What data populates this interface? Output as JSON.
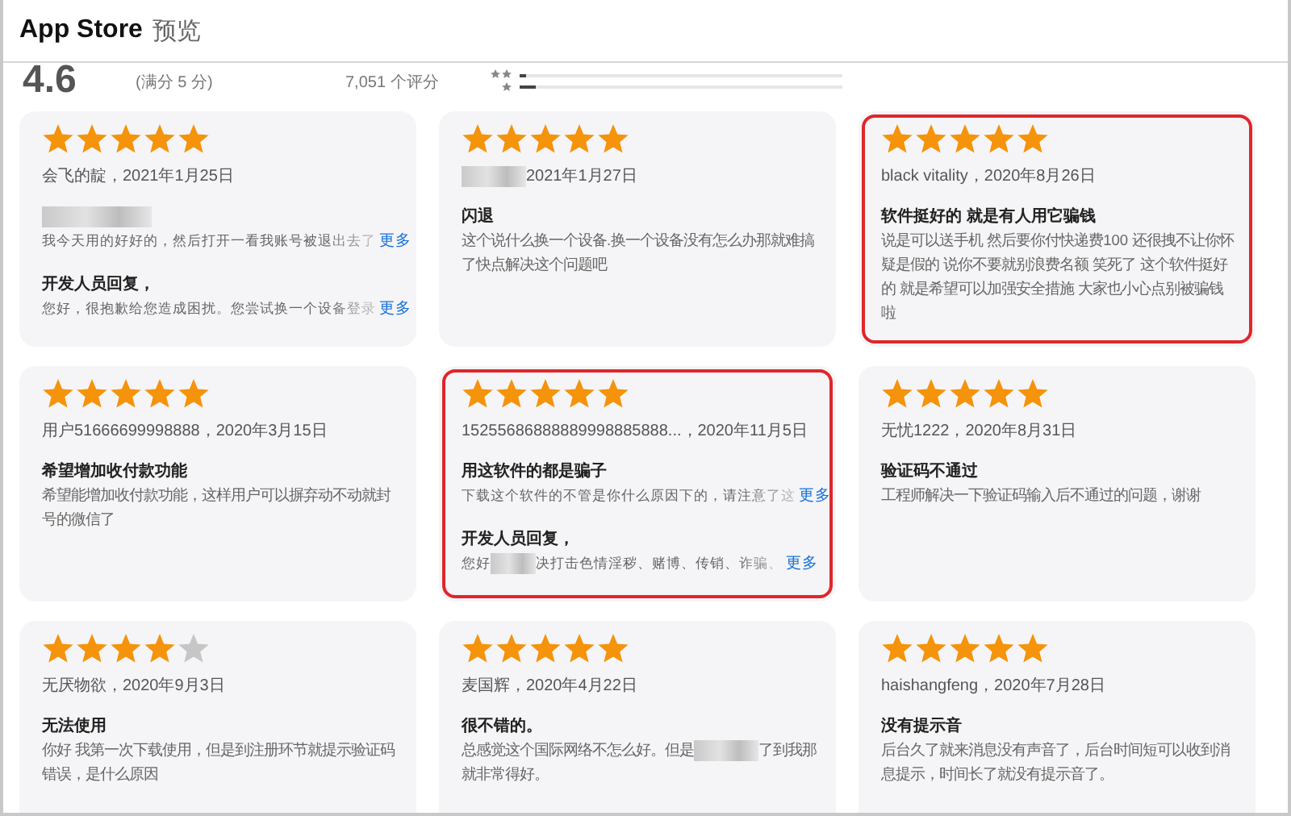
{
  "header": {
    "brand": "App Store",
    "subtitle": "预览"
  },
  "summary": {
    "score": "4.6",
    "out_of": "(满分 5 分)",
    "count": "7,051 个评分"
  },
  "reviews": [
    {
      "stars": 5,
      "highlighted": false,
      "author": [
        {
          "kind": "text",
          "text": "会飞的靛，2021年1月25日"
        }
      ],
      "title": [
        {
          "kind": "redacted"
        }
      ],
      "body": [
        {
          "kind": "text",
          "text": "我今天用的好好的，然后打开一看我账号被退出去了"
        }
      ],
      "body_more": "更多",
      "reply_title": "开发人员回复，",
      "reply": [
        {
          "kind": "text",
          "text": "您好，很抱歉给您造成困扰。您尝试换一个设备登录"
        }
      ],
      "reply_more": "更多"
    },
    {
      "stars": 5,
      "highlighted": false,
      "author": [
        {
          "kind": "redacted"
        },
        {
          "kind": "text",
          "text": "2021年1月27日"
        }
      ],
      "title": [
        {
          "kind": "text",
          "text": "闪退"
        }
      ],
      "body": [
        {
          "kind": "text",
          "text": "这个说什么换一个设备.换一个设备没有怎么办那就难搞了快点解决这个问题吧"
        }
      ]
    },
    {
      "stars": 5,
      "highlighted": true,
      "author": [
        {
          "kind": "text",
          "text": "black vitality，2020年8月26日"
        }
      ],
      "title": [
        {
          "kind": "text",
          "text": "软件挺好的 就是有人用它骗钱"
        }
      ],
      "body": [
        {
          "kind": "text",
          "text": "说是可以送手机 然后要你付快递费100 还很拽不让你怀疑是假的 说你不要就别浪费名额 笑死了 这个软件挺好的 就是希望可以加强安全措施 大家也小心点别被骗钱啦"
        }
      ]
    },
    {
      "stars": 5,
      "highlighted": false,
      "author": [
        {
          "kind": "text",
          "text": "用户51666699998888，2020年3月15日"
        }
      ],
      "title": [
        {
          "kind": "text",
          "text": "希望增加收付款功能"
        }
      ],
      "body": [
        {
          "kind": "text",
          "text": "希望能增加收付款功能，这样用户可以摒弃动不动就封号的微信了"
        }
      ]
    },
    {
      "stars": 5,
      "highlighted": true,
      "author": [
        {
          "kind": "text",
          "text": "15255686888889998885888...，2020年11月5日"
        }
      ],
      "title": [
        {
          "kind": "text",
          "text": "用这软件的都是骗子"
        }
      ],
      "body": [
        {
          "kind": "text",
          "text": "下载这个软件的不管是你什么原因下的，请注意了这"
        }
      ],
      "body_more": "更多",
      "reply_title": "开发人员回复，",
      "reply": [
        {
          "kind": "text",
          "text": "您好"
        },
        {
          "kind": "redacted"
        },
        {
          "kind": "text",
          "text": "决打击色情淫秽、赌博、传销、诈骗、"
        }
      ],
      "reply_more": "更多"
    },
    {
      "stars": 5,
      "highlighted": false,
      "author": [
        {
          "kind": "text",
          "text": "无忧1222，2020年8月31日"
        }
      ],
      "title": [
        {
          "kind": "text",
          "text": "验证码不通过"
        }
      ],
      "body": [
        {
          "kind": "text",
          "text": "工程师解决一下验证码输入后不通过的问题，谢谢"
        }
      ]
    },
    {
      "stars": 4,
      "highlighted": false,
      "author": [
        {
          "kind": "text",
          "text": "无厌物欲，2020年9月3日"
        }
      ],
      "title": [
        {
          "kind": "text",
          "text": "无法使用"
        }
      ],
      "body": [
        {
          "kind": "text",
          "text": "你好 我第一次下载使用，但是到注册环节就提示验证码错误，是什么原因"
        }
      ]
    },
    {
      "stars": 5,
      "highlighted": false,
      "author": [
        {
          "kind": "text",
          "text": "麦国辉，2020年4月22日"
        }
      ],
      "title": [
        {
          "kind": "text",
          "text": "很不错的。"
        }
      ],
      "body": [
        {
          "kind": "text",
          "text": "总感觉这个国际网络不怎么好。但是"
        },
        {
          "kind": "redacted"
        },
        {
          "kind": "text",
          "text": "了到我那就非常得好。"
        }
      ]
    },
    {
      "stars": 5,
      "highlighted": false,
      "author": [
        {
          "kind": "text",
          "text": "haishangfeng，2020年7月28日"
        }
      ],
      "title": [
        {
          "kind": "text",
          "text": "没有提示音"
        }
      ],
      "body": [
        {
          "kind": "text",
          "text": "后台久了就来消息没有声音了，后台时间短可以收到消息提示，时间长了就没有提示音了。"
        }
      ]
    }
  ]
}
